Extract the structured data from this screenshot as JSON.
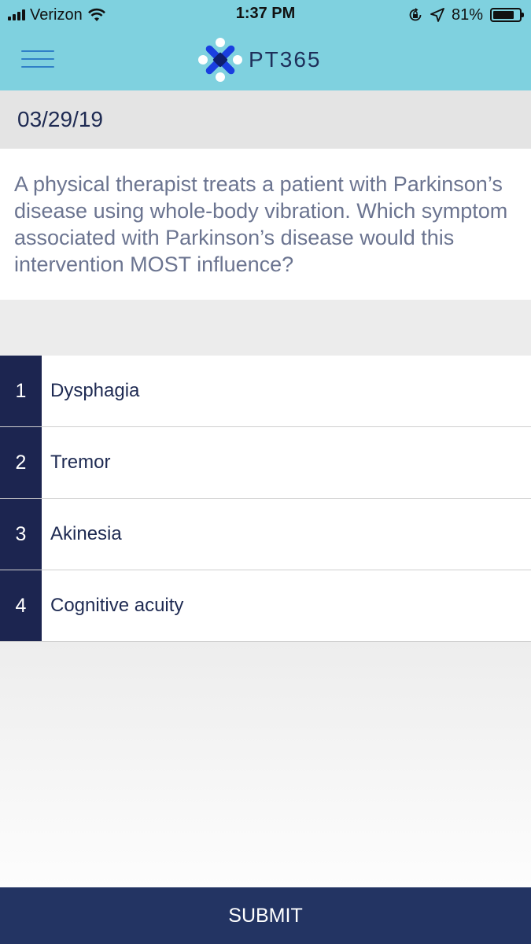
{
  "status_bar": {
    "carrier": "Verizon",
    "time": "1:37 PM",
    "battery_percent": "81%",
    "battery_level": 0.81
  },
  "app_bar": {
    "title": "PT365",
    "menu_icon": "hamburger-menu-icon",
    "logo_colors": [
      "#1a3fe0",
      "#0e1e6e",
      "#ffffff"
    ]
  },
  "date": "03/29/19",
  "question": "A physical therapist treats a patient with Parkinson’s disease using whole-body vibration. Which symptom associated with Parkinson’s disease would this intervention MOST influence?",
  "options": [
    {
      "number": "1",
      "label": "Dysphagia"
    },
    {
      "number": "2",
      "label": "Tremor"
    },
    {
      "number": "3",
      "label": "Akinesia"
    },
    {
      "number": "4",
      "label": "Cognitive acuity"
    }
  ],
  "submit_label": "SUBMIT",
  "colors": {
    "header": "#7fd1df",
    "navy": "#1c2550",
    "submit": "#233463",
    "question_text": "#6b7490"
  }
}
